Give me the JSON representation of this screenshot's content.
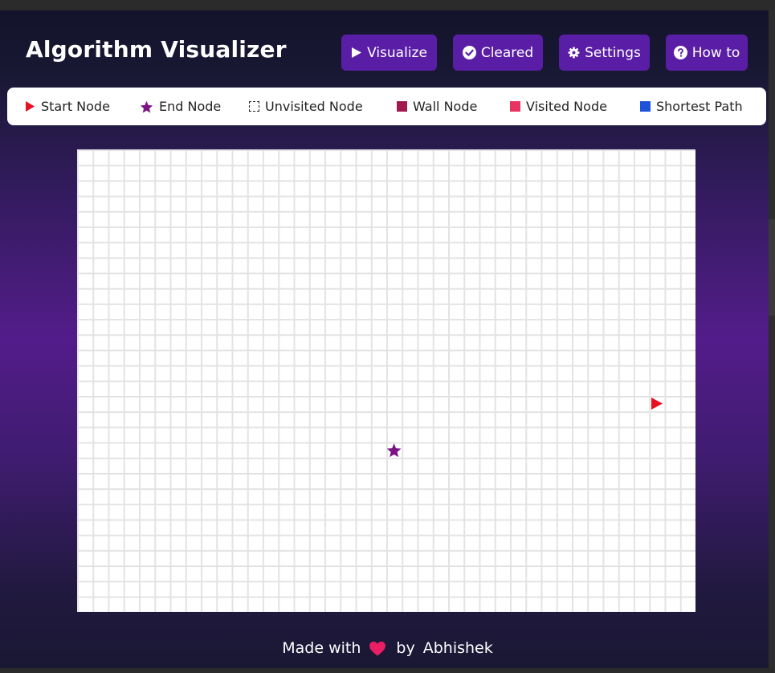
{
  "header": {
    "title": "Algorithm Visualizer",
    "buttons": [
      {
        "label": "Visualize",
        "icon": "play-icon"
      },
      {
        "label": "Cleared",
        "icon": "check-circle-icon"
      },
      {
        "label": "Settings",
        "icon": "gear-icon"
      },
      {
        "label": "How to",
        "icon": "question-circle-icon"
      }
    ]
  },
  "legend": [
    {
      "label": "Start Node",
      "icon": "triangle-right-icon",
      "color": "#e81123"
    },
    {
      "label": "End Node",
      "icon": "star-icon",
      "color": "#7b1286"
    },
    {
      "label": "Unvisited Node",
      "icon": "dashed-square-icon",
      "color": "#222222"
    },
    {
      "label": "Wall Node",
      "icon": "square-icon",
      "color": "#a0194f"
    },
    {
      "label": "Visited Node",
      "icon": "square-icon",
      "color": "#e6335f"
    },
    {
      "label": "Shortest Path",
      "icon": "square-icon",
      "color": "#1e52d8"
    }
  ],
  "grid": {
    "columns": 40,
    "rows": 30,
    "start_node": {
      "col": 37,
      "row": 16,
      "color": "#e81123"
    },
    "end_node": {
      "col": 20,
      "row": 19,
      "color": "#7b1286"
    }
  },
  "footer": {
    "made_with": "Made with",
    "heart_color": "#e91e63",
    "by": "by",
    "author": "Abhishek"
  },
  "colors": {
    "button_bg": "#5a1ea6",
    "background_mid": "#531c8a",
    "background_dark": "#14132b"
  }
}
